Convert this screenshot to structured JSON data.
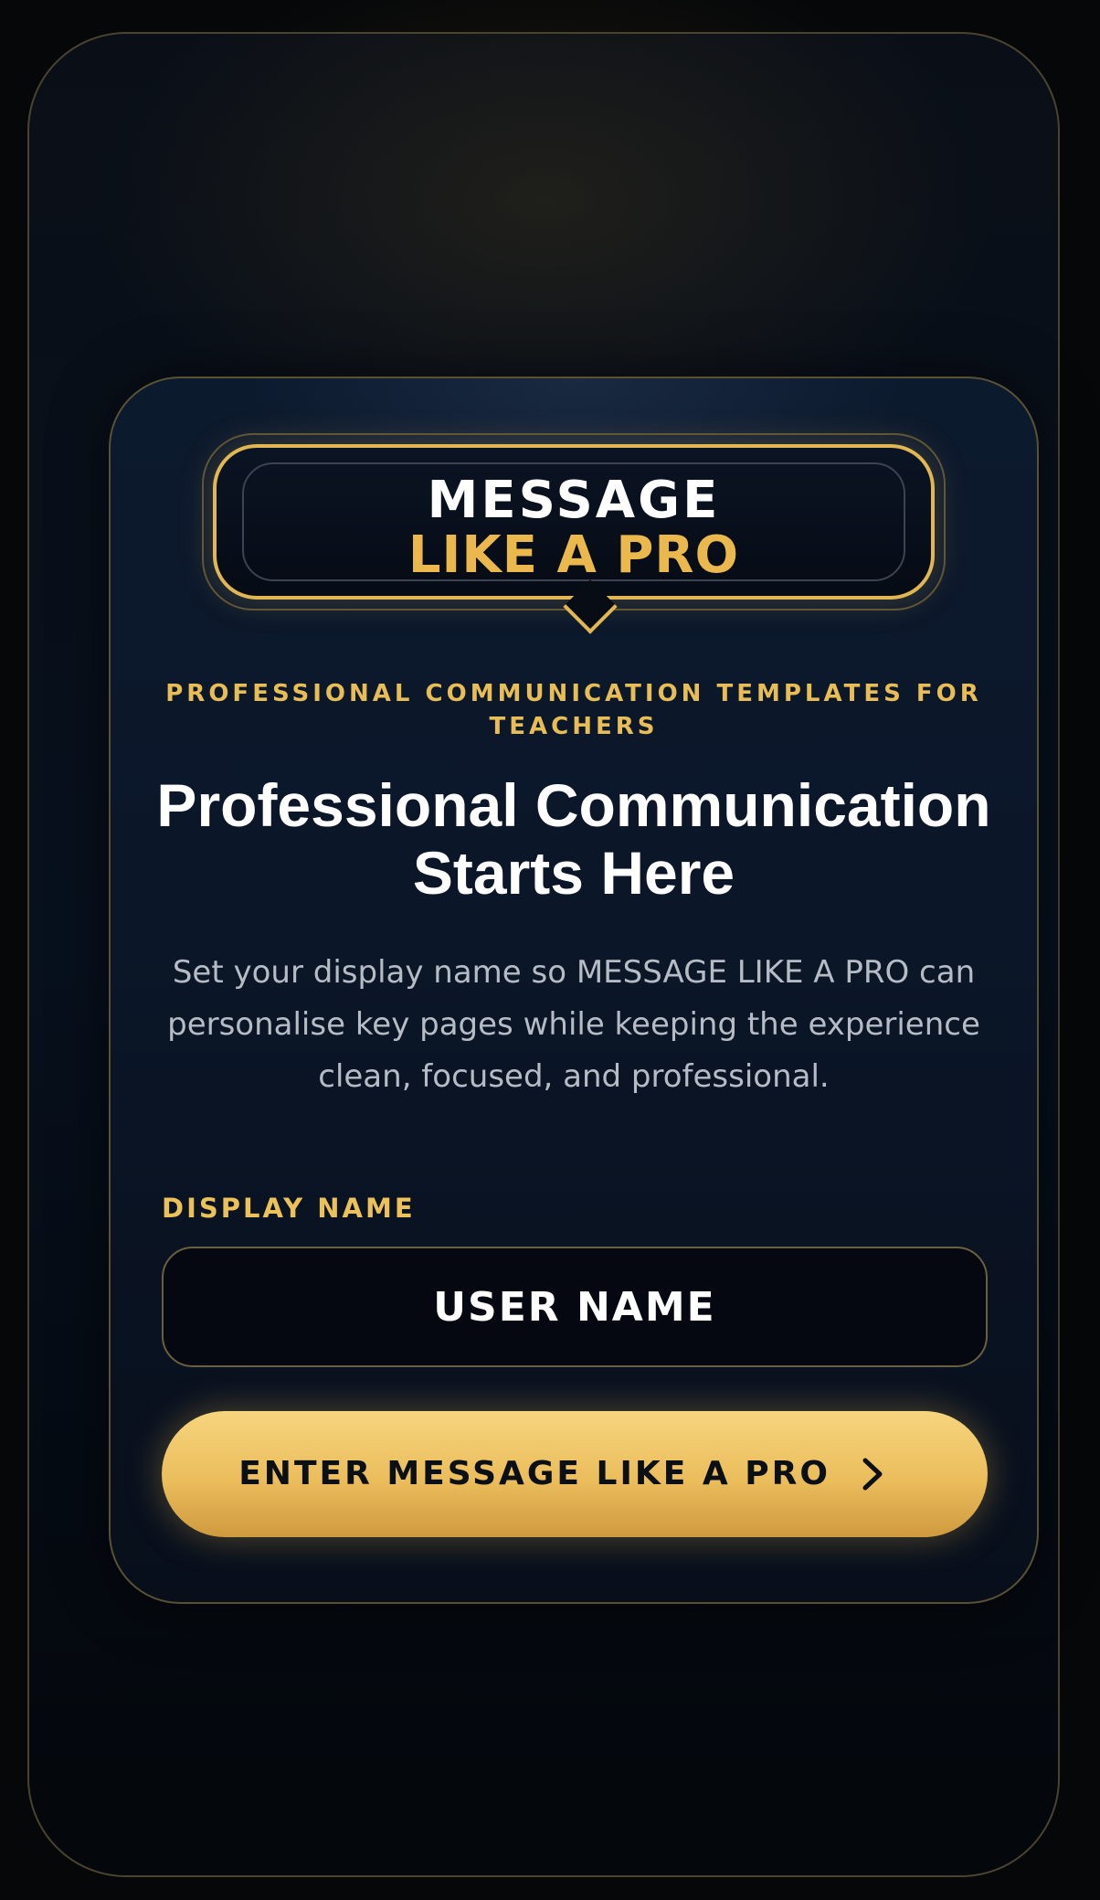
{
  "badge": {
    "line1": "MESSAGE",
    "line2": "LIKE A PRO"
  },
  "kicker": "PROFESSIONAL COMMUNICATION TEMPLATES FOR TEACHERS",
  "headline": "Professional Communication Starts Here",
  "intro": "Set your display name so MESSAGE LIKE A PRO can personalise key pages while keeping the experience clean, focused, and professional.",
  "form": {
    "label": "DISPLAY NAME",
    "placeholder": "USER NAME",
    "value": ""
  },
  "cta": {
    "label": "ENTER MESSAGE LIKE A PRO",
    "icon": "chevron-right-icon"
  },
  "colors": {
    "accent": "#e8bd55",
    "background": "#050709",
    "card": "#0b1628"
  }
}
